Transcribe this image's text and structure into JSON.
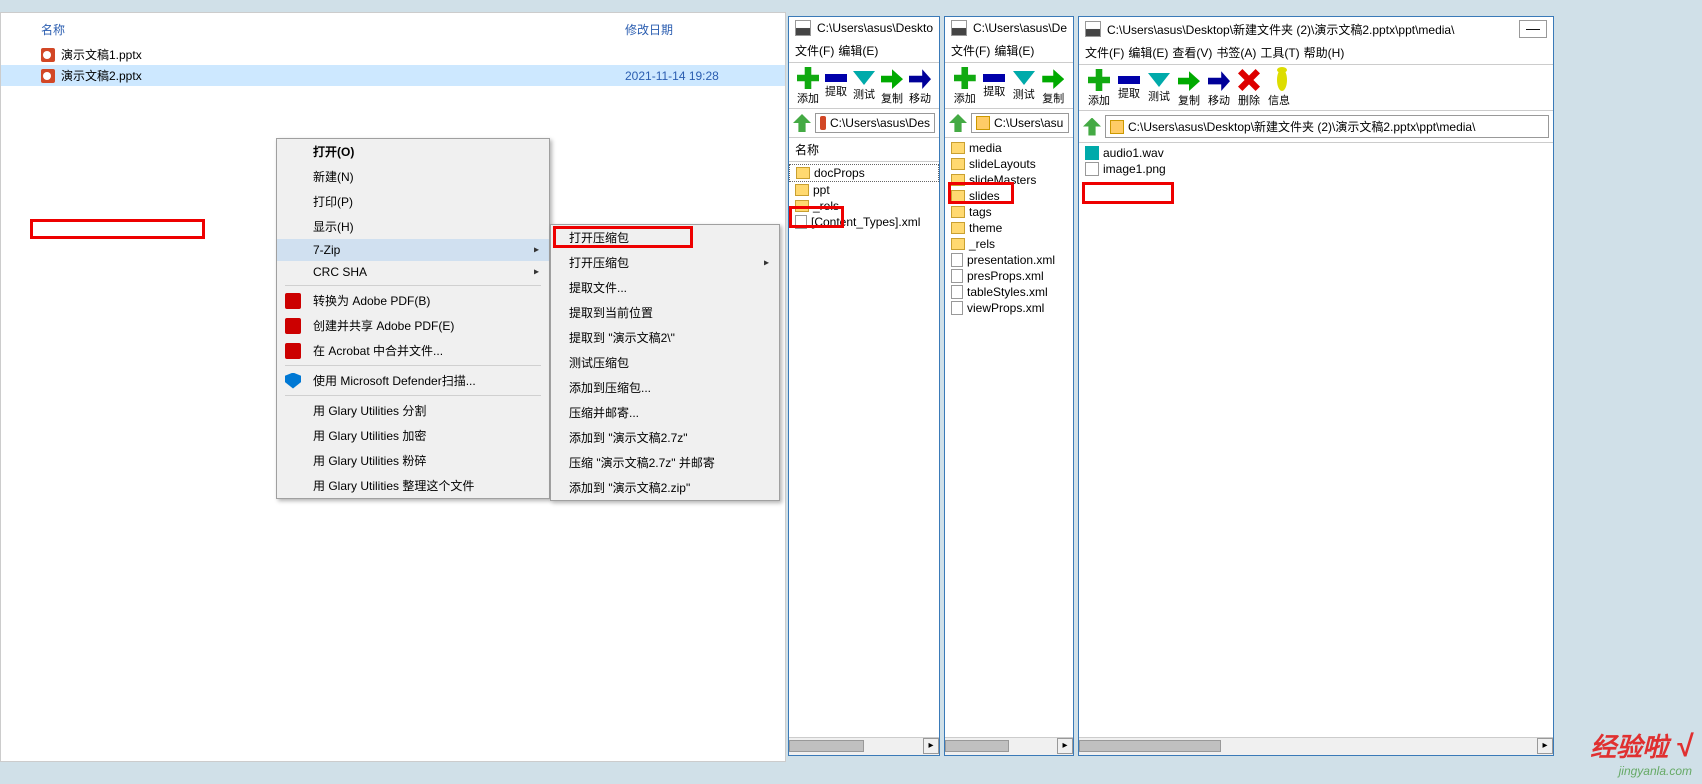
{
  "explorer": {
    "col_name": "名称",
    "col_date": "修改日期",
    "files": [
      {
        "name": "演示文稿1.pptx",
        "date": ""
      },
      {
        "name": "演示文稿2.pptx",
        "date": "2021-11-14 19:28"
      }
    ]
  },
  "context_menu": {
    "open": "打开(O)",
    "new": "新建(N)",
    "print": "打印(P)",
    "show": "显示(H)",
    "seven_zip": "7-Zip",
    "crc_sha": "CRC SHA",
    "convert_pdf": "转换为 Adobe PDF(B)",
    "create_share_pdf": "创建并共享 Adobe PDF(E)",
    "acrobat_merge": "在 Acrobat 中合并文件...",
    "defender": "使用 Microsoft Defender扫描...",
    "glary_split": "用 Glary Utilities 分割",
    "glary_encrypt": "用 Glary Utilities 加密",
    "glary_shred": "用 Glary Utilities 粉碎",
    "glary_tidy": "用 Glary Utilities 整理这个文件"
  },
  "sub_menu": {
    "open_archive": "打开压缩包",
    "open_archive_sub": "打开压缩包",
    "extract_files": "提取文件...",
    "extract_here": "提取到当前位置",
    "extract_to": "提取到 \"演示文稿2\\\"",
    "test_archive": "测试压缩包",
    "add_to_archive": "添加到压缩包...",
    "compress_mail": "压缩并邮寄...",
    "add_7z": "添加到 \"演示文稿2.7z\"",
    "compress_7z_mail": "压缩 \"演示文稿2.7z\" 并邮寄",
    "add_zip": "添加到 \"演示文稿2.zip\""
  },
  "toolbar_labels": {
    "add": "添加",
    "extract": "提取",
    "test": "测试",
    "copy": "复制",
    "move": "移动",
    "delete": "删除",
    "info": "信息"
  },
  "menubar": {
    "file": "文件(F)",
    "edit": "编辑(E)",
    "view": "查看(V)",
    "bookmark": "书签(A)",
    "tool": "工具(T)",
    "help": "帮助(H)"
  },
  "win_a": {
    "title": "C:\\Users\\asus\\Desktop",
    "addr": "C:\\Users\\asus\\Des",
    "hdr": "名称",
    "items": [
      {
        "t": "folder",
        "n": "docProps"
      },
      {
        "t": "folder",
        "n": "ppt"
      },
      {
        "t": "folder",
        "n": "_rels"
      },
      {
        "t": "xml",
        "n": "[Content_Types].xml"
      }
    ]
  },
  "win_b": {
    "title": "C:\\Users\\asus\\Des",
    "addr": "C:\\Users\\asu",
    "items": [
      {
        "t": "folder",
        "n": "media"
      },
      {
        "t": "folder",
        "n": "slideLayouts"
      },
      {
        "t": "folder",
        "n": "slideMasters"
      },
      {
        "t": "folder",
        "n": "slides"
      },
      {
        "t": "folder",
        "n": "tags"
      },
      {
        "t": "folder",
        "n": "theme"
      },
      {
        "t": "folder",
        "n": "_rels"
      },
      {
        "t": "xml",
        "n": "presentation.xml"
      },
      {
        "t": "xml",
        "n": "presProps.xml"
      },
      {
        "t": "xml",
        "n": "tableStyles.xml"
      },
      {
        "t": "xml",
        "n": "viewProps.xml"
      }
    ]
  },
  "win_c": {
    "title": "C:\\Users\\asus\\Desktop\\新建文件夹 (2)\\演示文稿2.pptx\\ppt\\media\\",
    "addr": "C:\\Users\\asus\\Desktop\\新建文件夹 (2)\\演示文稿2.pptx\\ppt\\media\\",
    "items": [
      {
        "t": "wav",
        "n": "audio1.wav"
      },
      {
        "t": "png",
        "n": "image1.png"
      }
    ]
  },
  "watermark": {
    "cn": "经验啦",
    "check": "√",
    "url": "jingyanla.com"
  }
}
